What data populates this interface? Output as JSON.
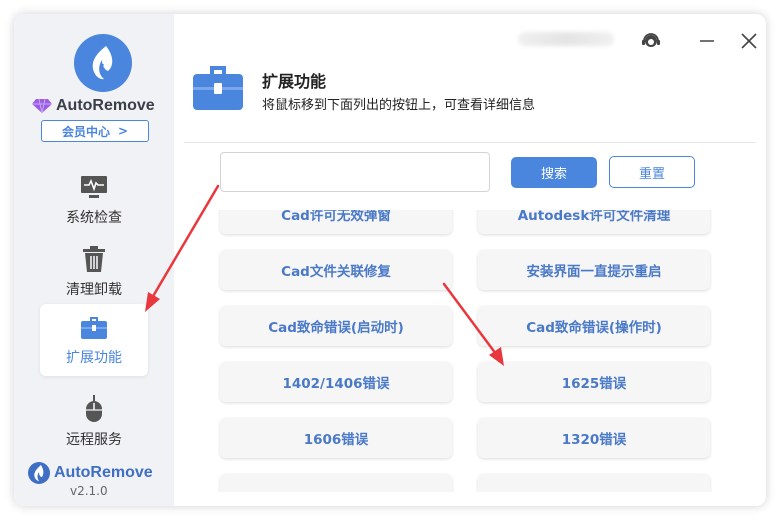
{
  "app": {
    "brand": "AutoRemove",
    "member_center": "会员中心",
    "member_chevron": ">",
    "version": "v2.1.0",
    "colors": {
      "accent": "#4a86de",
      "sidebar_bg": "#f1f2f5",
      "arrow": "#e8383d"
    }
  },
  "sidebar": {
    "items": [
      {
        "label": "系统检查",
        "icon": "monitor-icon",
        "active": false
      },
      {
        "label": "清理卸载",
        "icon": "trash-icon",
        "active": false
      },
      {
        "label": "扩展功能",
        "icon": "toolbox-icon",
        "active": true
      },
      {
        "label": "远程服务",
        "icon": "mouse-icon",
        "active": false
      }
    ]
  },
  "window_controls": {
    "support": "headset-icon",
    "minimize": "minimize-icon",
    "close": "close-icon"
  },
  "header": {
    "title": "扩展功能",
    "subtitle": "将鼠标移到下面列出的按钮上，可查看详细信息"
  },
  "search": {
    "value": "",
    "placeholder": "",
    "search_label": "搜索",
    "reset_label": "重置"
  },
  "tools": [
    "Cad许可无效弹窗",
    "Autodesk许可文件清理",
    "Cad文件关联修复",
    "安装界面一直提示重启",
    "Cad致命错误(启动时)",
    "Cad致命错误(操作时)",
    "1402/1406错误",
    "1625错误",
    "1606错误",
    "1320错误"
  ]
}
